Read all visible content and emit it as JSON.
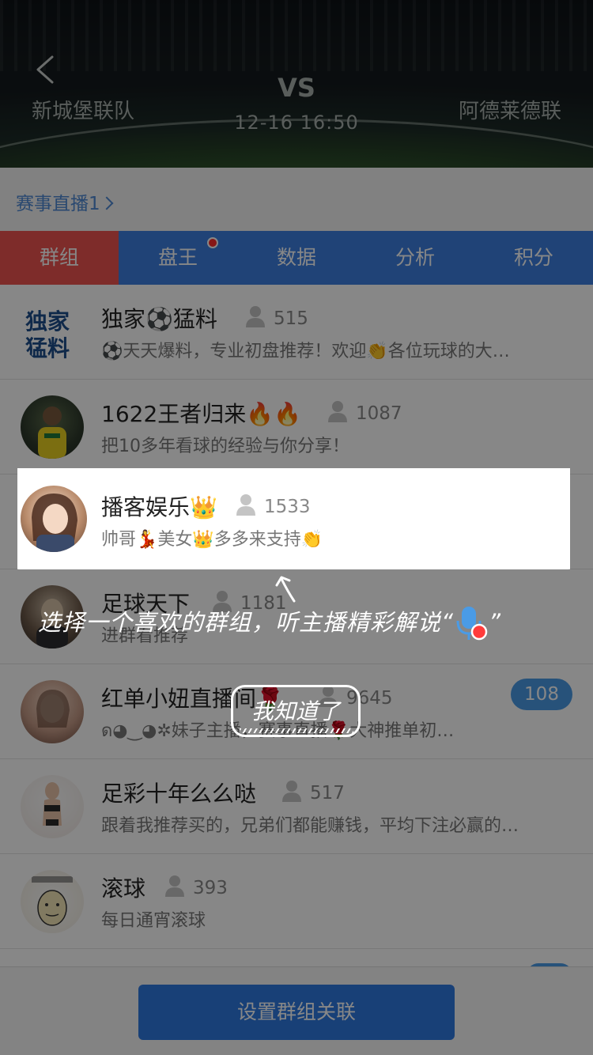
{
  "header": {
    "home_team": "新城堡联队",
    "away_team": "阿德莱德联",
    "vs": "VS",
    "match_time": "12-16  16:50"
  },
  "live": {
    "label": "赛事直播1"
  },
  "tabs": [
    {
      "label": "群组",
      "active": true
    },
    {
      "label": "盘王",
      "has_dot": true
    },
    {
      "label": "数据"
    },
    {
      "label": "分析"
    },
    {
      "label": "积分"
    }
  ],
  "groups": [
    {
      "name": "独家⚽猛料",
      "count": "515",
      "desc": "⚽天天爆料，专业初盘推荐！欢迎👏各位玩球的大…"
    },
    {
      "name": "1622王者归来🔥🔥",
      "count": "1087",
      "desc": "把10多年看球的经验与你分享！"
    },
    {
      "name": "播客娱乐👑",
      "count": "1533",
      "desc": "帅哥💃美女👑多多来支持👏"
    },
    {
      "name": "足球天下",
      "count": "1181",
      "desc": "进群看推荐"
    },
    {
      "name": "红单小妞直播间🌹",
      "count": "9645",
      "desc": "ด◕‿◕✲妹子主播，赛事直播🌹大神推单初…",
      "badge": "108"
    },
    {
      "name": "足彩十年么么哒",
      "count": "517",
      "desc": "跟着我推荐买的，兄弟们都能赚钱，平均下注必赢的…"
    },
    {
      "name": "滚球",
      "count": "393",
      "desc": "每日通宵滚球"
    }
  ],
  "bottom": {
    "button_label": "设置群组关联"
  },
  "guide": {
    "hint_text": "选择一个喜欢的群组，听主播精彩解说“",
    "hint_close_quote": "”",
    "got_it_label": "我知道了"
  },
  "colors": {
    "tab_blue": "#3d7fe0",
    "tab_red": "#ee5350",
    "link_blue": "#4e89d4",
    "badge_blue": "#4a9be6",
    "button_blue": "#2f7ae0"
  }
}
